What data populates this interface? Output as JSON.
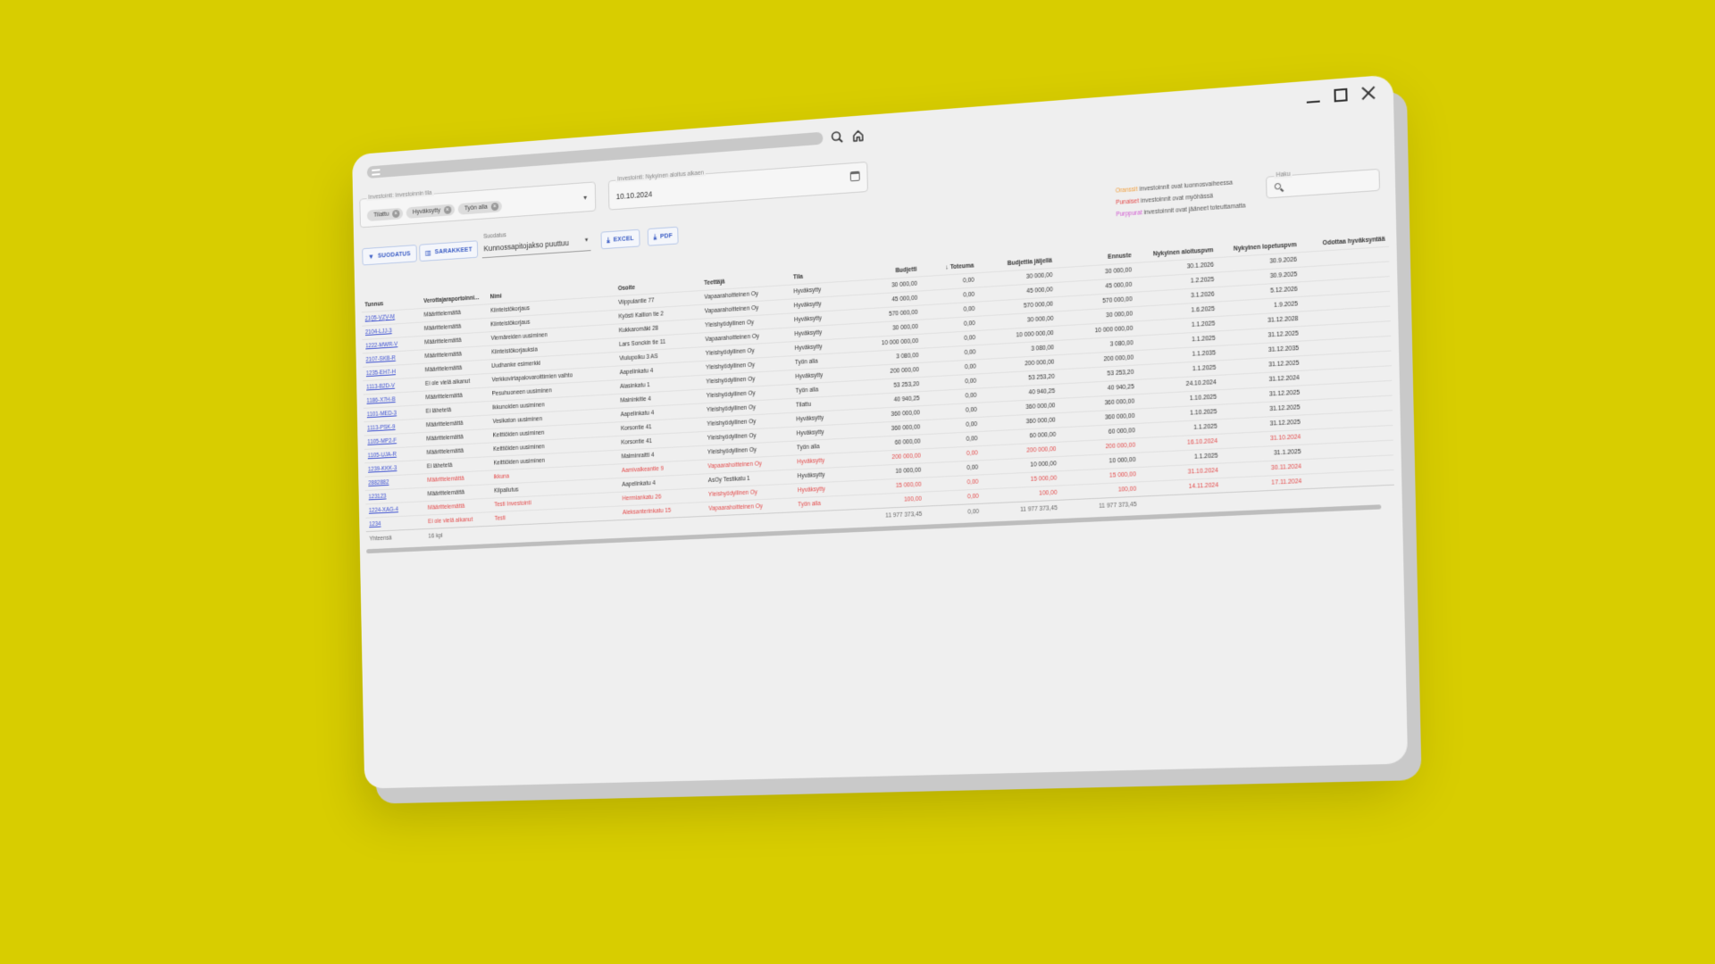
{
  "filters": {
    "status_label": "Investointi: Investoinnin tila",
    "status_chips": [
      "Tilattu",
      "Hyväksytty",
      "Työn alla"
    ],
    "date_label": "Investointi: Nykyinen aloitus alkaen",
    "date_value": "10.10.2024"
  },
  "toolbar": {
    "filter_btn": "SUODATUS",
    "columns_btn": "SARAKKEET",
    "filter_select_label": "Suodatus",
    "filter_select_value": "Kunnossapitojakso puuttuu",
    "excel_btn": "EXCEL",
    "pdf_btn": "PDF"
  },
  "legend": {
    "orange_word": "Oranssit",
    "orange_text": "investoinnit ovat luonnosvaiheessa",
    "red_word": "Punaiset",
    "red_text": "investoinnit ovat myöhässä",
    "purple_word": "Purppurat",
    "purple_text": "investoinnit ovat jääneet toteuttamatta"
  },
  "search": {
    "label": "Haku",
    "placeholder": ""
  },
  "colors": {
    "accent": "#3a5cc4",
    "link": "#3b4fd0",
    "red": "#e34a4a",
    "orange": "#f0a040",
    "purple": "#d15ad1",
    "background": "#d8cd00"
  },
  "table": {
    "headers": [
      "Tunnus",
      "Verottajaraportoinni...",
      "Nimi",
      "Osoite",
      "Teettäjä",
      "Tila",
      "Budjetti",
      "Toteuma",
      "Budjettia jäljellä",
      "Ennuste",
      "Nykyinen aloituspvm",
      "Nykyinen lopetuspvm",
      "Odottaa hyväksyntää"
    ],
    "rows": [
      {
        "late": false,
        "cells": [
          "2105-VZV-M",
          "Määrittelemättä",
          "Kiinteistökorjaus",
          "Viippulantie 77",
          "Vapaarahoitteinen Oy",
          "Hyväksytty",
          "30 000,00",
          "0,00",
          "30 000,00",
          "30 000,00",
          "30.1.2026",
          "30.9.2026",
          ""
        ]
      },
      {
        "late": false,
        "cells": [
          "2104-LJJ-3",
          "Määrittelemättä",
          "Kiinteistökorjaus",
          "Kyösti Kallion tie 2",
          "Vapaarahoitteinen Oy",
          "Hyväksytty",
          "45 000,00",
          "0,00",
          "45 000,00",
          "45 000,00",
          "1.2.2025",
          "30.9.2025",
          ""
        ]
      },
      {
        "late": false,
        "cells": [
          "1222-MWR-V",
          "Määrittelemättä",
          "Viemäreiden uusiminen",
          "Kukkaromäki 28",
          "Yleishyödyllinen Oy",
          "Hyväksytty",
          "570 000,00",
          "0,00",
          "570 000,00",
          "570 000,00",
          "3.1.2026",
          "5.12.2026",
          ""
        ]
      },
      {
        "late": false,
        "cells": [
          "2107-SKB-R",
          "Määrittelemättä",
          "Kiinteistökorjauksia",
          "Lars Sonckin tie 11",
          "Vapaarahoitteinen Oy",
          "Hyväksytty",
          "30 000,00",
          "0,00",
          "30 000,00",
          "30 000,00",
          "1.6.2025",
          "1.9.2025",
          ""
        ]
      },
      {
        "late": false,
        "cells": [
          "1235-EH7-H",
          "Määrittelemättä",
          "Uudhanke esimerkki",
          "Viulupoiku 3 AS",
          "Yleishyödyllinen Oy",
          "Hyväksytty",
          "10 000 000,00",
          "0,00",
          "10 000 000,00",
          "10 000 000,00",
          "1.1.2025",
          "31.12.2028",
          ""
        ]
      },
      {
        "late": false,
        "cells": [
          "1113-B2D-V",
          "Ei ole vielä alkanut",
          "Verkkovirtapalovaroittimien vaihto",
          "Aapelinkatu 4",
          "Yleishyödyllinen Oy",
          "Työn alla",
          "3 080,00",
          "0,00",
          "3 080,00",
          "3 080,00",
          "1.1.2025",
          "31.12.2025",
          ""
        ]
      },
      {
        "late": false,
        "cells": [
          "1186-X7H-B",
          "Määrittelemättä",
          "Pesuhuoneen uusiminen",
          "Alasinkatu 1",
          "Yleishyödyllinen Oy",
          "Hyväksytty",
          "200 000,00",
          "0,00",
          "200 000,00",
          "200 000,00",
          "1.1.2035",
          "31.12.2035",
          ""
        ]
      },
      {
        "late": false,
        "cells": [
          "1101-MED-3",
          "Ei lähetetä",
          "Ikkunoiden uusiminen",
          "Maininkitie 4",
          "Yleishyödyllinen Oy",
          "Työn alla",
          "53 253,20",
          "0,00",
          "53 253,20",
          "53 253,20",
          "1.1.2025",
          "31.12.2025",
          ""
        ]
      },
      {
        "late": false,
        "cells": [
          "1113-PSK-9",
          "Määrittelemättä",
          "Vesikaton uusiminen",
          "Aapelinkatu 4",
          "Yleishyödyllinen Oy",
          "Tilattu",
          "40 940,25",
          "0,00",
          "40 940,25",
          "40 940,25",
          "24.10.2024",
          "31.12.2024",
          ""
        ]
      },
      {
        "late": false,
        "cells": [
          "1105-MP2-F",
          "Määrittelemättä",
          "Keittiöiden uusiminen",
          "Korsontie 41",
          "Yleishyödyllinen Oy",
          "Hyväksytty",
          "360 000,00",
          "0,00",
          "360 000,00",
          "360 000,00",
          "1.10.2025",
          "31.12.2025",
          ""
        ]
      },
      {
        "late": false,
        "cells": [
          "1105-UJA-R",
          "Määrittelemättä",
          "Keittiöiden uusiminen",
          "Korsontie 41",
          "Yleishyödyllinen Oy",
          "Hyväksytty",
          "360 000,00",
          "0,00",
          "360 000,00",
          "360 000,00",
          "1.10.2025",
          "31.12.2025",
          ""
        ]
      },
      {
        "late": false,
        "cells": [
          "1239-KKK-3",
          "Ei lähetetä",
          "Keittiöiden uusiminen",
          "Malminraitti 4",
          "Yleishyödyllinen Oy",
          "Työn alla",
          "60 000,00",
          "0,00",
          "60 000,00",
          "60 000,00",
          "1.1.2025",
          "31.12.2025",
          ""
        ]
      },
      {
        "late": true,
        "cells": [
          "2882882",
          "Määrittelemättä",
          "ikkuna",
          "Aamivalkeantie 9",
          "Vapaarahoitteinen Oy",
          "Hyväksytty",
          "200 000,00",
          "0,00",
          "200 000,00",
          "200 000,00",
          "16.10.2024",
          "31.10.2024",
          ""
        ]
      },
      {
        "late": false,
        "cells": [
          "123123",
          "Määrittelemättä",
          "Kilpailutus",
          "Aapelinkatu 4",
          "AsOy Testikatu 1",
          "Hyväksytty",
          "10 000,00",
          "0,00",
          "10 000,00",
          "10 000,00",
          "1.1.2025",
          "31.1.2025",
          ""
        ]
      },
      {
        "late": true,
        "cells": [
          "1224-XAG-4",
          "Määrittelemättä",
          "Testi Investointi",
          "Hermiankatu 26",
          "Yleishyödyllinen Oy",
          "Hyväksytty",
          "15 000,00",
          "0,00",
          "15 000,00",
          "15 000,00",
          "31.10.2024",
          "30.11.2024",
          ""
        ]
      },
      {
        "late": true,
        "cells": [
          "1234",
          "Ei ole vielä alkanut",
          "Testi",
          "Aleksanterinkatu 15",
          "Vapaarahoitteinen Oy",
          "Työn alla",
          "100,00",
          "0,00",
          "100,00",
          "100,00",
          "14.11.2024",
          "17.11.2024",
          ""
        ]
      }
    ],
    "totals": {
      "label": "Yhteensä",
      "count": "16 kpl",
      "budjetti": "11 977 373,45",
      "toteuma": "0,00",
      "jaljella": "11 977 373,45",
      "ennuste": "11 977 373,45"
    }
  }
}
